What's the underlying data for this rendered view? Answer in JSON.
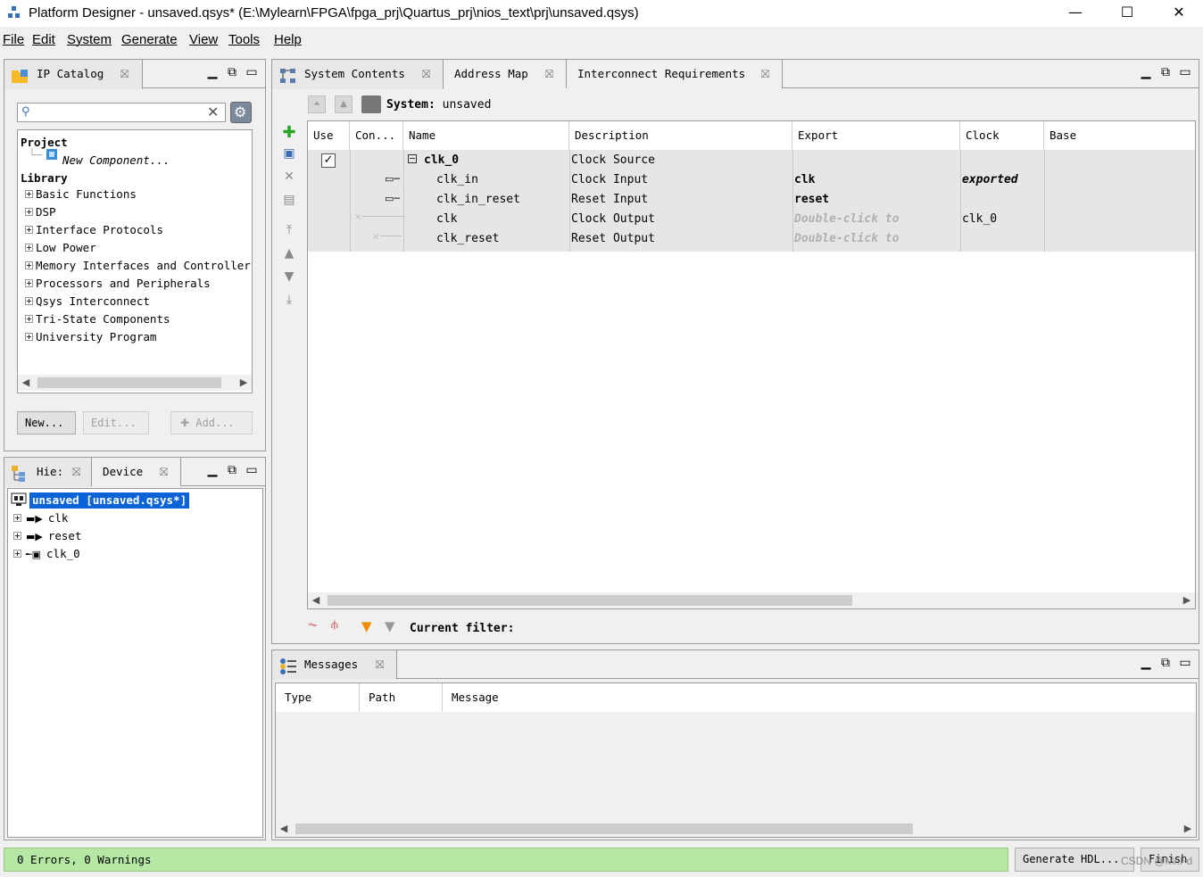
{
  "window": {
    "title": "Platform Designer - unsaved.qsys* (E:\\Mylearn\\FPGA\\fpga_prj\\Quartus_prj\\nios_text\\prj\\unsaved.qsys)",
    "minimize": "—",
    "maximize": "☐",
    "close": "✕"
  },
  "menu": [
    "File",
    "Edit",
    "System",
    "Generate",
    "View",
    "Tools",
    "Help"
  ],
  "ip_catalog": {
    "tab_label": "IP Catalog",
    "project_label": "Project",
    "new_component": "New Component...",
    "library_label": "Library",
    "library_items": [
      "Basic Functions",
      "DSP",
      "Interface Protocols",
      "Low Power",
      "Memory Interfaces and Controller",
      "Processors and Peripherals",
      "Qsys Interconnect",
      "Tri-State Components",
      "University Program"
    ],
    "buttons": {
      "new": "New...",
      "edit": "Edit...",
      "add": "Add..."
    }
  },
  "hierarchy": {
    "tab_label": "Hie:",
    "device_tab": "Device",
    "root": "unsaved [unsaved.qsys*]",
    "items": [
      "clk",
      "reset",
      "clk_0"
    ]
  },
  "system_contents": {
    "tabs": [
      "System Contents",
      "Address Map",
      "Interconnect Requirements"
    ],
    "system_label": "System:",
    "system_name": "unsaved",
    "columns": [
      "Use",
      "Con...",
      "Name",
      "Description",
      "Export",
      "Clock",
      "Base"
    ],
    "rows": [
      {
        "name": "clk_0",
        "description": "Clock Source",
        "export": "",
        "clock": ""
      },
      {
        "name": "clk_in",
        "description": "Clock Input",
        "export": "clk",
        "clock": "exported"
      },
      {
        "name": "clk_in_reset",
        "description": "Reset Input",
        "export": "reset",
        "clock": ""
      },
      {
        "name": "clk",
        "description": "Clock Output",
        "export": "Double-click to",
        "clock": "clk_0"
      },
      {
        "name": "clk_reset",
        "description": "Reset Output",
        "export": "Double-click to",
        "clock": ""
      }
    ],
    "filter_label": "Current filter:"
  },
  "messages": {
    "tab_label": "Messages",
    "columns": [
      "Type",
      "Path",
      "Message"
    ]
  },
  "status": {
    "text": "0 Errors, 0 Warnings",
    "generate_button": "Generate HDL...",
    "finish_button": "Finish",
    "watermark": "CSDN @Mr.Fd"
  },
  "colors": {
    "status_ok": "#b5e8a4",
    "selection": "#0a64d8",
    "add_green": "#2aa52a"
  }
}
